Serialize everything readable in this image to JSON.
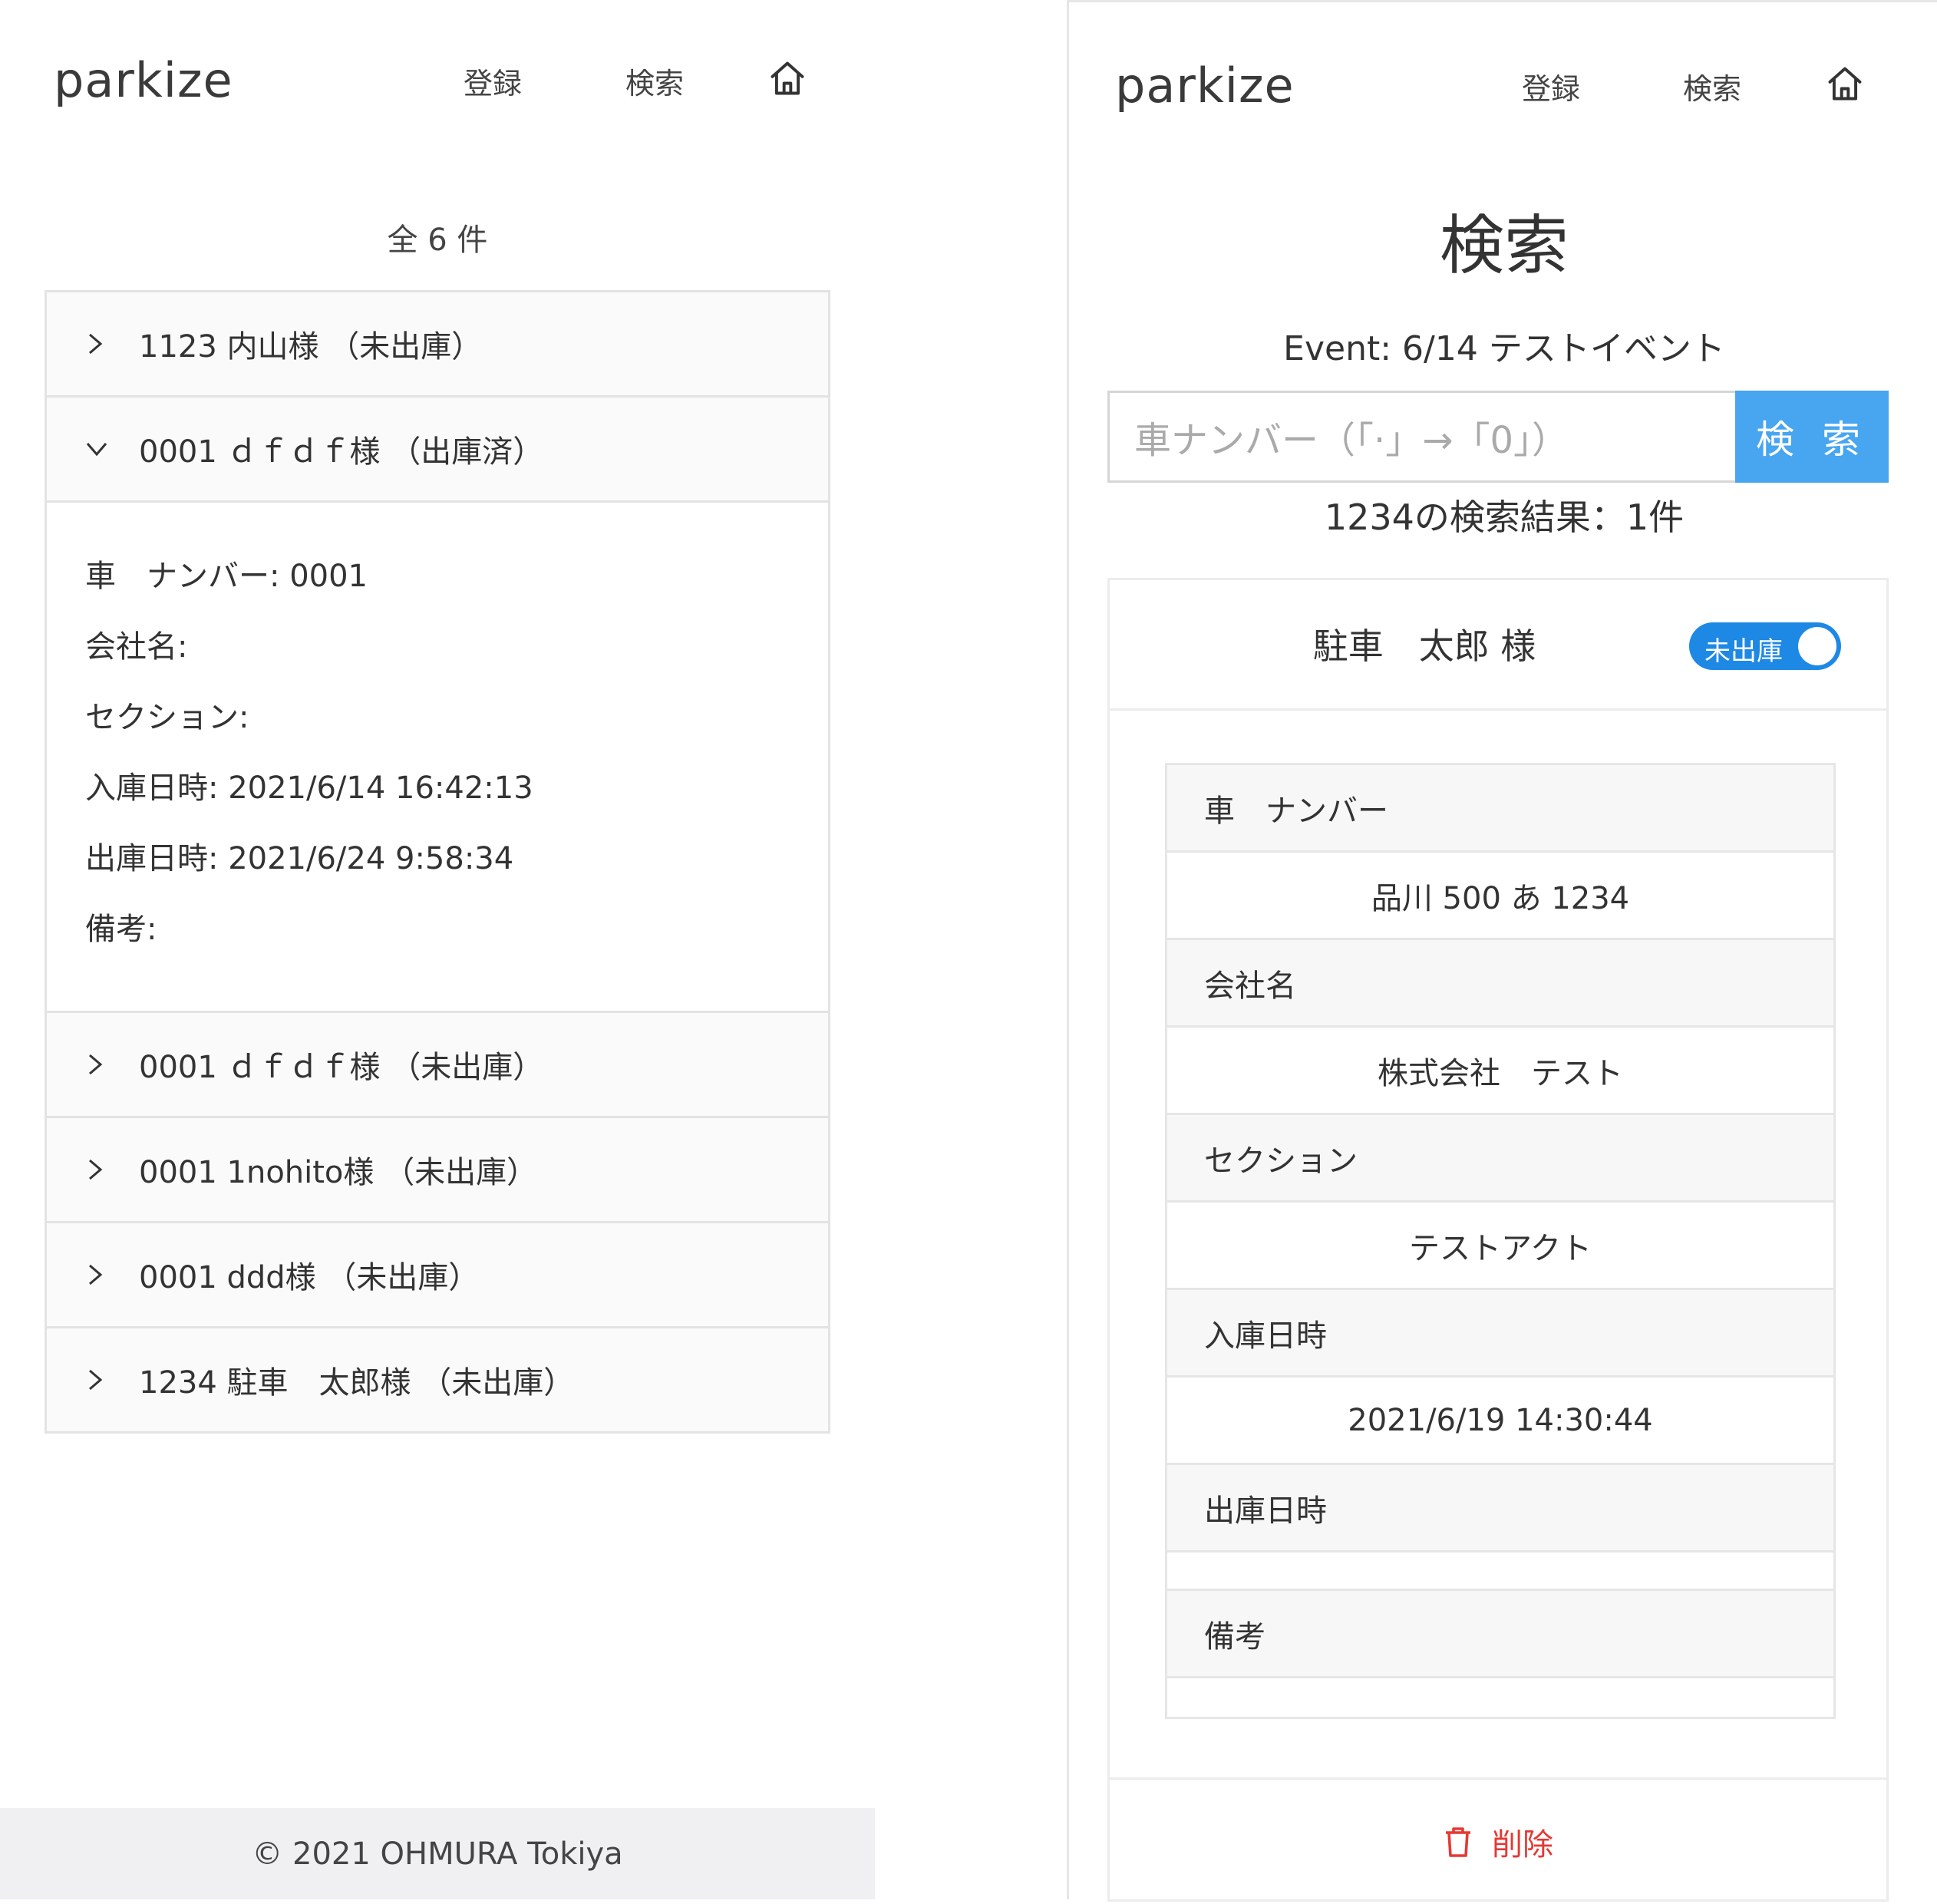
{
  "left": {
    "brand": "parkize",
    "nav": {
      "register": "登録",
      "search": "検索"
    },
    "count": "全 6 件",
    "items": [
      {
        "title": "1123 内山様 （未出庫）",
        "expanded": false
      },
      {
        "title": "0001 ｄｆｄｆ様 （出庫済）",
        "expanded": true
      },
      {
        "title": "0001 ｄｆｄｆ様 （未出庫）",
        "expanded": false
      },
      {
        "title": "0001 1nohito様 （未出庫）",
        "expanded": false
      },
      {
        "title": "0001 ddd様 （未出庫）",
        "expanded": false
      },
      {
        "title": "1234 駐車　太郎様 （未出庫）",
        "expanded": false
      }
    ],
    "details": {
      "car_number": "車　ナンバー: 0001",
      "company": "会社名:",
      "section": "セクション:",
      "entry_time": "入庫日時: 2021/6/14 16:42:13",
      "exit_time": "出庫日時: 2021/6/24 9:58:34",
      "note": "備考:"
    },
    "footer": "© 2021 OHMURA Tokiya"
  },
  "right": {
    "brand": "parkize",
    "nav": {
      "register": "登録",
      "search": "検索"
    },
    "title": "検索",
    "event": "Event: 6/14 テストイベント",
    "search": {
      "placeholder": "車ナンバー（「·」→「0」）",
      "button": "検 索"
    },
    "result": "1234の検索結果：1件",
    "card": {
      "name": "駐車　太郎 様",
      "status": "未出庫",
      "rows": [
        {
          "label": "車　ナンバー",
          "value": "品川 500 あ 1234"
        },
        {
          "label": "会社名",
          "value": "株式会社　テスト"
        },
        {
          "label": "セクション",
          "value": "テストアクト"
        },
        {
          "label": "入庫日時",
          "value": "2021/6/19 14:30:44"
        },
        {
          "label": "出庫日時",
          "value": ""
        },
        {
          "label": "備考",
          "value": ""
        }
      ],
      "delete": "削除"
    }
  },
  "colors": {
    "accent": "#48a5ef",
    "toggle": "#1e88e5",
    "danger": "#e53935"
  }
}
